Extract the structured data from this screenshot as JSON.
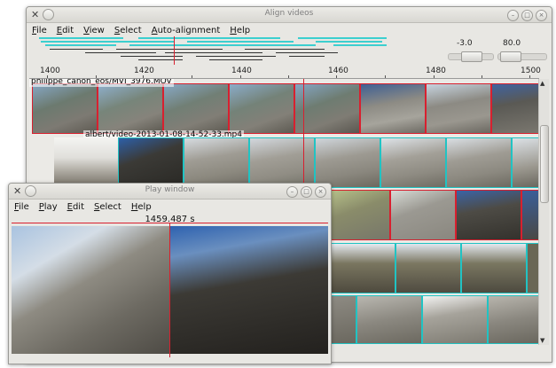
{
  "main_window": {
    "title": "Align videos",
    "menu": [
      "File",
      "Edit",
      "View",
      "Select",
      "Auto-alignment",
      "Help"
    ],
    "slider_left_value": "-3.0",
    "slider_right_value": "80.0",
    "ruler_labels": [
      "1400",
      "1420",
      "1440",
      "1460",
      "1480",
      "1500"
    ],
    "tracks": [
      {
        "label": "philippe_canon_eos/MVI_3976.MOV"
      },
      {
        "label": "albert/video-2013-01-08-14-52-33.mp4"
      }
    ]
  },
  "play_window": {
    "title": "Play window",
    "menu": [
      "File",
      "Play",
      "Edit",
      "Select",
      "Help"
    ],
    "time": "1459.487 s"
  },
  "colors": {
    "selected_border": "#d8202f",
    "track_border": "#21c3c3",
    "window_bg": "#e8e7e3"
  }
}
